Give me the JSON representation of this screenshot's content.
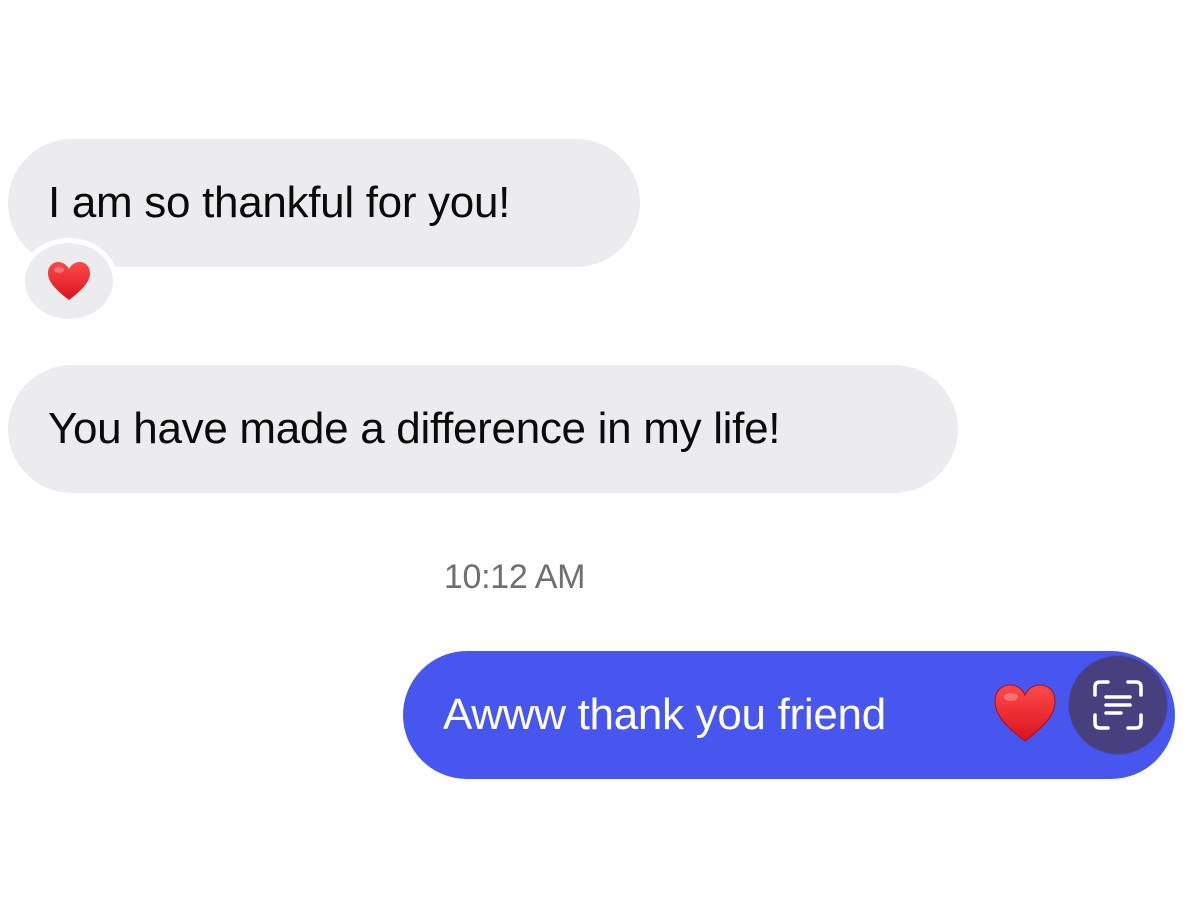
{
  "conversation": {
    "messages": [
      {
        "direction": "received",
        "text": "I am so thankful for you!",
        "reaction": "❤️"
      },
      {
        "direction": "received",
        "text": "You have made a difference in my life!"
      },
      {
        "direction": "sent",
        "text": "Awww thank you friend",
        "trailing_emoji": "❤️"
      }
    ],
    "timestamp": "10:12 AM"
  },
  "controls": {
    "live_text_button": {
      "icon": "text-scan-icon"
    }
  },
  "colors": {
    "received_bubble": "#ececee",
    "sent_bubble": "#4856f0",
    "heart": "#e8242f",
    "scan_button": "#48407e",
    "timestamp_text": "#6e6e73"
  }
}
